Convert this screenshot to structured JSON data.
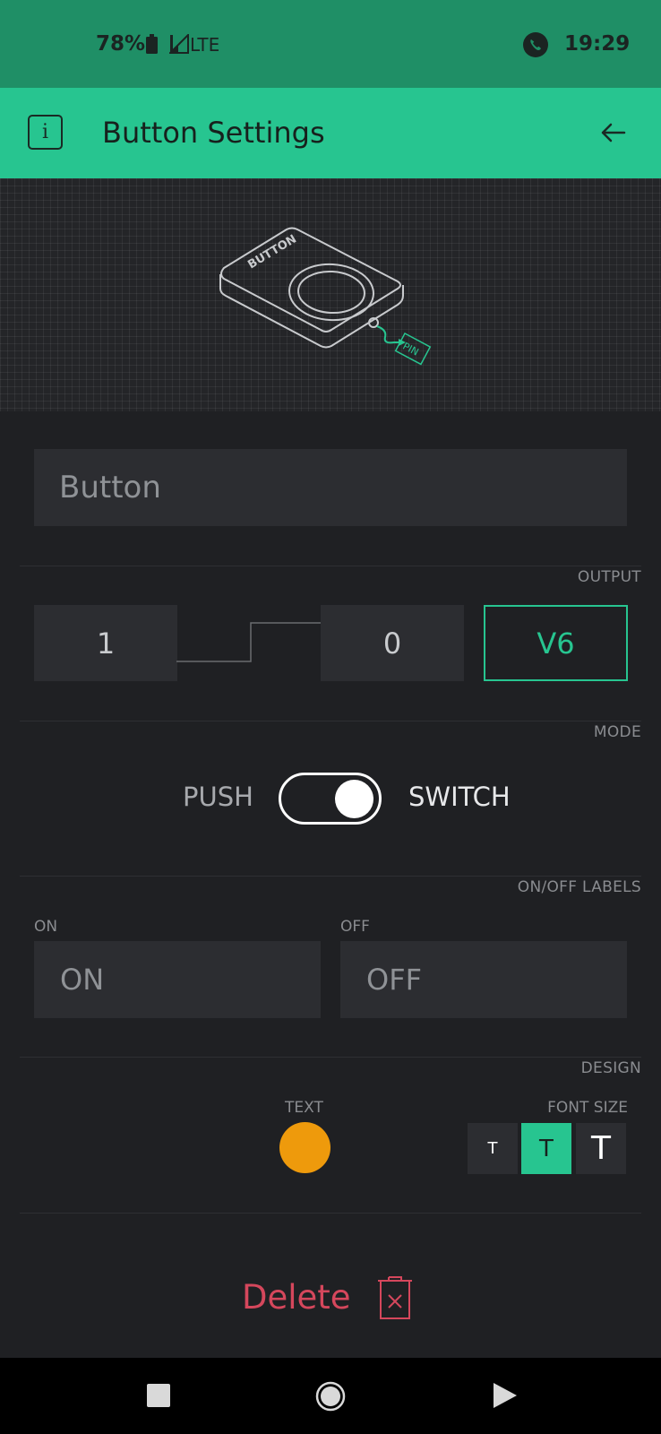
{
  "status": {
    "battery": "78%",
    "network": "LTE",
    "time": "19:29"
  },
  "appbar": {
    "title": "Button Settings"
  },
  "widget": {
    "name_value": "Button",
    "illustration_label": "BUTTON",
    "illustration_pin": "PIN"
  },
  "output": {
    "section_label": "OUTPUT",
    "high_value": "1",
    "low_value": "0",
    "pin": "V6"
  },
  "mode": {
    "section_label": "MODE",
    "push_label": "PUSH",
    "switch_label": "SWITCH",
    "selected": "SWITCH"
  },
  "labels": {
    "section_label": "ON/OFF LABELS",
    "on_caption": "ON",
    "off_caption": "OFF",
    "on_value": "ON",
    "off_value": "OFF"
  },
  "design": {
    "section_label": "DESIGN",
    "text_caption": "TEXT",
    "text_color": "#ee9a0c",
    "font_size_caption": "FONT SIZE",
    "font_sizes": [
      "T",
      "T",
      "T"
    ],
    "font_size_selected_index": 1
  },
  "delete": {
    "label": "Delete"
  },
  "colors": {
    "accent": "#27c590",
    "danger": "#d5475c",
    "statusbar": "#1f8f66",
    "background": "#1f2023"
  },
  "icons": {
    "info": "info-icon",
    "back": "arrow-left-icon",
    "delete": "trash-icon",
    "nav": [
      "square-recents-icon",
      "circle-home-icon",
      "triangle-back-icon"
    ]
  }
}
